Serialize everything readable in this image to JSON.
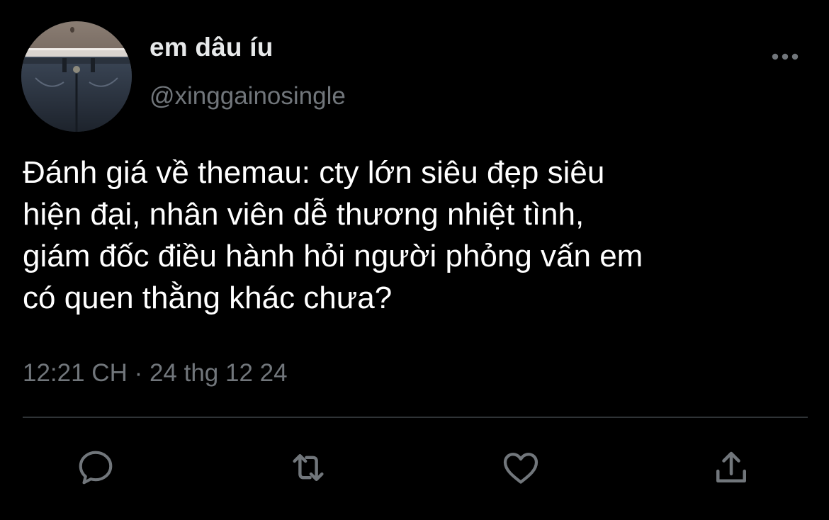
{
  "author": {
    "display_name": "em dâu íu",
    "handle": "@xinggainosingle"
  },
  "tweet": {
    "text": "Đánh giá về themau: cty lớn siêu đẹp siêu\nhiện đại, nhân viên dễ thương nhiệt tình,\ngiám đốc điều hành hỏi người phỏng vấn em\ncó quen thằng khác chưa?",
    "timestamp": "12:21 CH · 24 thg 12 24"
  },
  "actions": {
    "reply_icon": "comment-bubble-icon",
    "retweet_icon": "retweet-arrows-icon",
    "like_icon": "heart-icon",
    "share_icon": "share-upload-icon"
  },
  "colors": {
    "background": "#000000",
    "primary_text": "#e7e9ea",
    "secondary_text": "#71767b",
    "divider": "#2f3336"
  }
}
